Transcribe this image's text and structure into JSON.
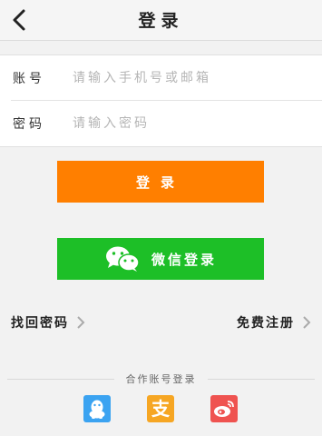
{
  "header": {
    "title": "登录",
    "back_icon": "chevron-left-icon"
  },
  "form": {
    "account_label": "账号",
    "account_placeholder": "请输入手机号或邮箱",
    "password_label": "密码",
    "password_placeholder": "请输入密码"
  },
  "buttons": {
    "login_label": "登录",
    "wechat_label": "微信登录",
    "login_color": "#ff7f00",
    "wechat_color": "#1dbf27"
  },
  "links": {
    "forgot_password": "找回密码",
    "register": "免费注册"
  },
  "cooperation": {
    "title": "合作账号登录",
    "providers": [
      {
        "name": "qq-icon",
        "color": "#3ba3f1"
      },
      {
        "name": "alipay-icon",
        "color": "#f6a623",
        "glyph": "支"
      },
      {
        "name": "weibo-icon",
        "color": "#ef5350"
      }
    ]
  }
}
